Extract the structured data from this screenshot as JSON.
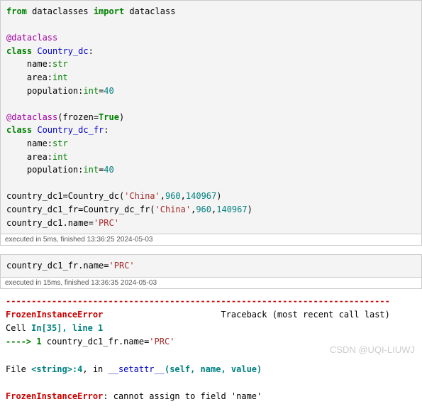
{
  "cell1": {
    "kw_from": "from",
    "mod": " dataclasses ",
    "kw_import": "import",
    "imp": " dataclass",
    "dec1": "@dataclass",
    "kw_class": "class",
    "cls1": " Country_dc",
    "colon": ":",
    "f1a": "    name:",
    "t_str": "str",
    "f1b": "    area:",
    "t_int": "int",
    "f1c": "    population:",
    "eq40": "=",
    "n40": "40",
    "dec2_pre": "@dataclass",
    "dec2_open": "(frozen=",
    "dec2_true": "True",
    "dec2_close": ")",
    "cls2": " Country_dc_fr",
    "line_a1": "country_dc1=Country_dc(",
    "s_china": "'China'",
    "comma": ",",
    "n960": "960",
    "n140967": "140967",
    "close_paren": ")",
    "line_a2": "country_dc1_fr=Country_dc_fr(",
    "line_a3": "country_dc1.name=",
    "s_prc": "'PRC'"
  },
  "exec1": "executed in 5ms, finished 13:36:25 2024-05-03",
  "cell2": {
    "line": "country_dc1_fr.name=",
    "s_prc": "'PRC'"
  },
  "exec2": "executed in 15ms, finished 13:36:35 2024-05-03",
  "out": {
    "dash": "---------------------------------------------------------------------------",
    "err_name": "FrozenInstanceError",
    "traceback": "Traceback (most recent call last)",
    "cell_lbl": "Cell ",
    "in_n": "In[35], line 1",
    "arrow": "----> 1",
    "body": " country_dc1_fr.name=",
    "s_prc": "'PRC'",
    "file_pre": "File ",
    "file_str": "<string>:4",
    "file_in": ", in ",
    "dunder": "__setattr__",
    "sig": "(self, name, value)",
    "err_msg": ": cannot assign to field 'name'"
  },
  "watermark": "CSDN @UQI-LIUWJ"
}
